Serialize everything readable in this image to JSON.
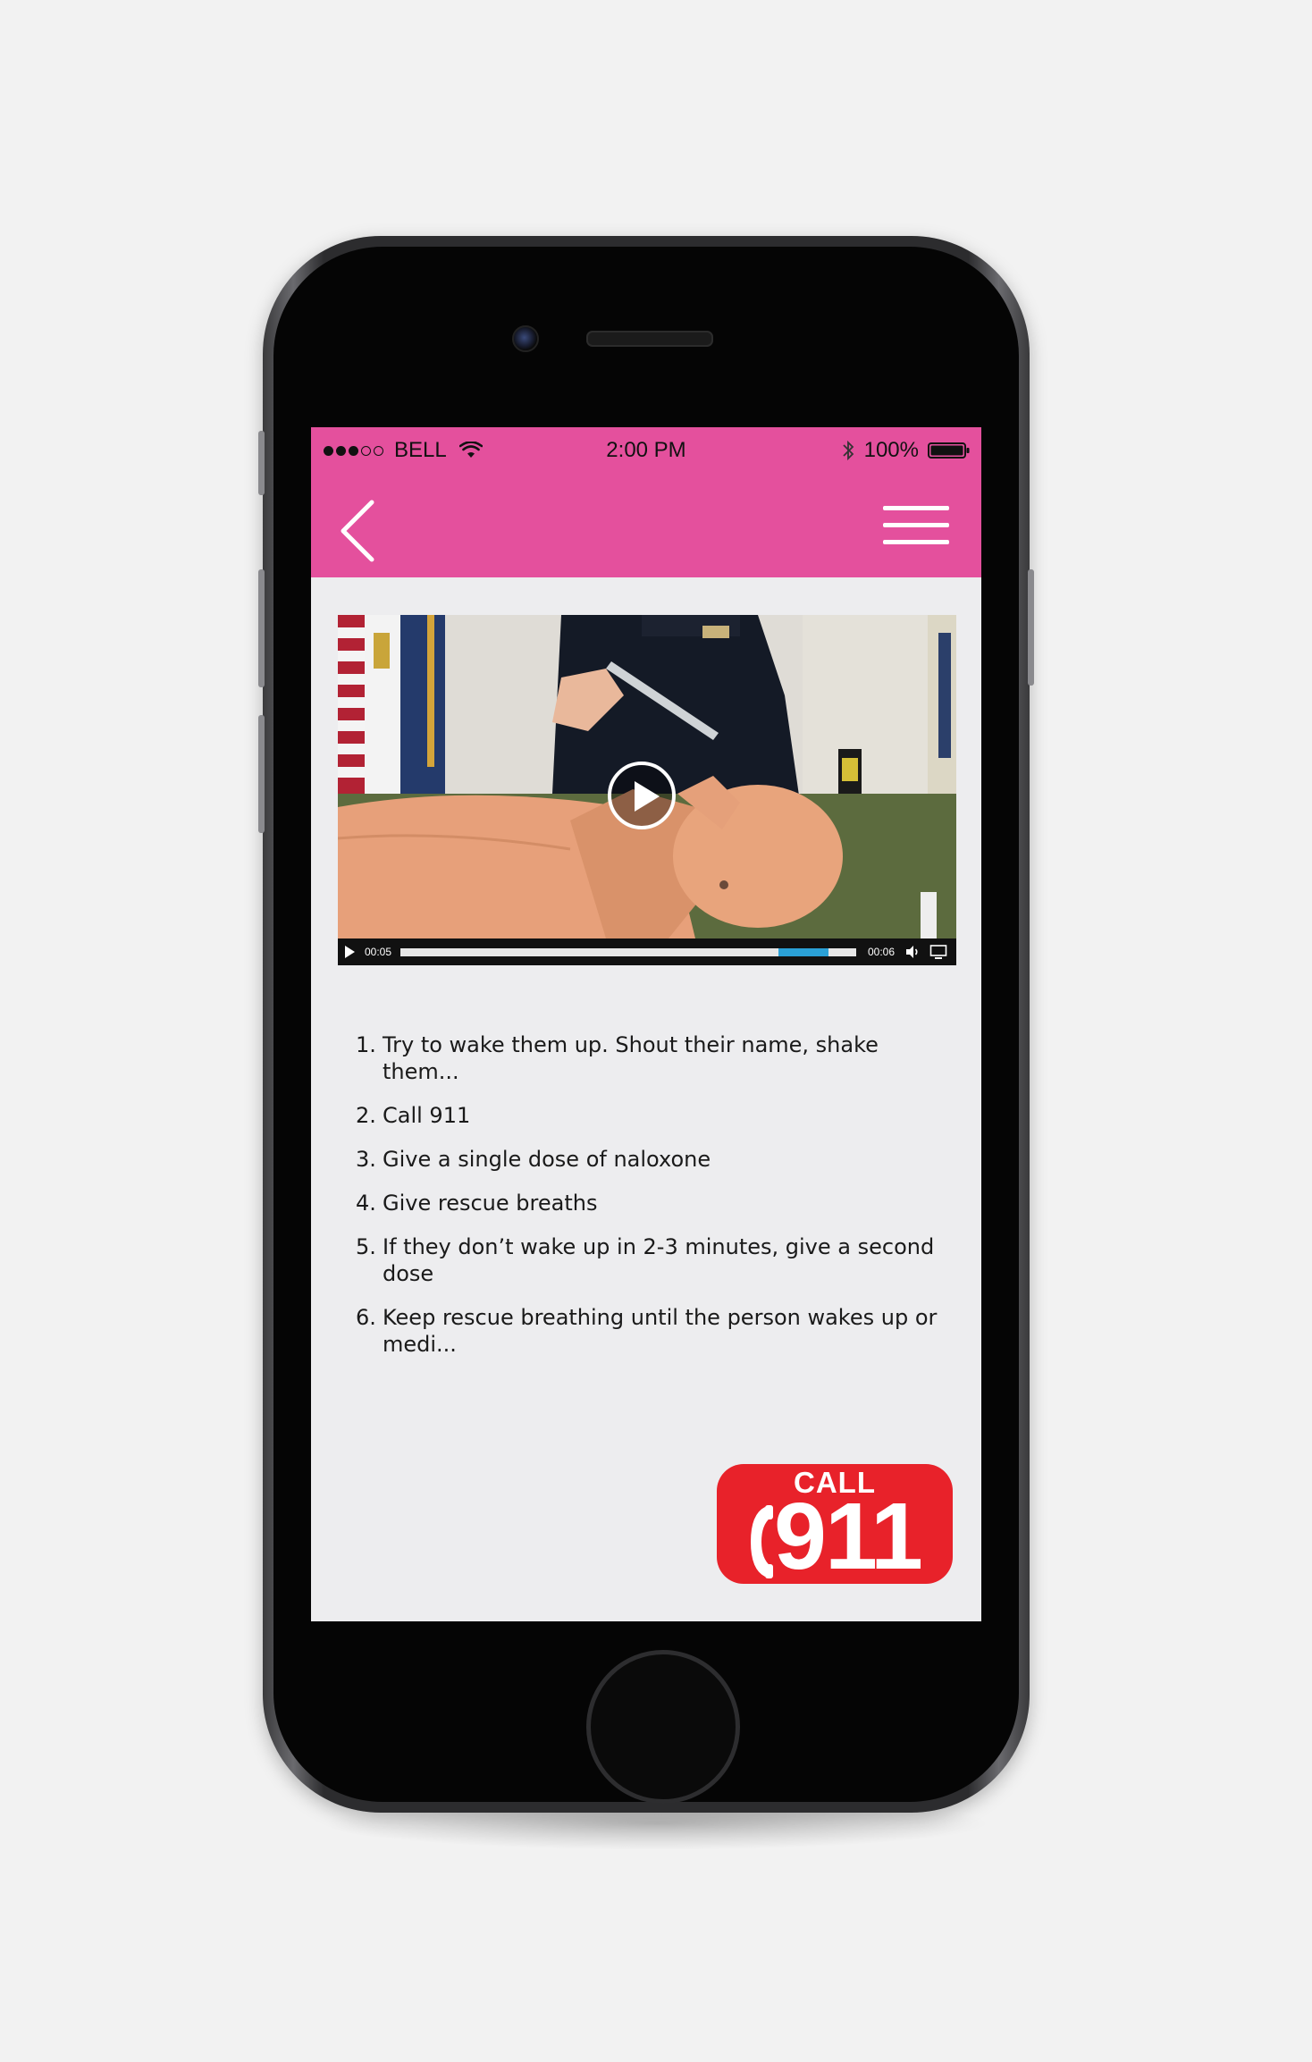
{
  "status_bar": {
    "carrier": "BELL",
    "time": "2:00 PM",
    "battery": "100%",
    "signal_bars_filled": 3,
    "signal_bars_total": 5
  },
  "nav": {
    "back_icon": "chevron-left-icon",
    "menu_icon": "hamburger-menu-icon"
  },
  "video": {
    "current_time": "00:05",
    "duration": "00:06",
    "progress_fraction": 0.83,
    "buffered_end_fraction": 0.94
  },
  "steps": [
    {
      "num": "1.",
      "text": "Try to wake them up. Shout their name, shake them..."
    },
    {
      "num": "2.",
      "text": "Call 911"
    },
    {
      "num": "3.",
      "text": "Give a single dose of naloxone"
    },
    {
      "num": "4.",
      "text": "Give rescue breaths"
    },
    {
      "num": "5.",
      "text": "If they don’t wake up in 2-3 minutes, give a second dose"
    },
    {
      "num": "6.",
      "text": "Keep rescue breathing until the person wakes up or medi..."
    }
  ],
  "call_button": {
    "label": "CALL",
    "number": "911",
    "icon": "phone-handset-icon"
  },
  "colors": {
    "header_pink": "#e4509d",
    "call_red": "#e8222a",
    "progress_blue": "#2aa0d6"
  }
}
